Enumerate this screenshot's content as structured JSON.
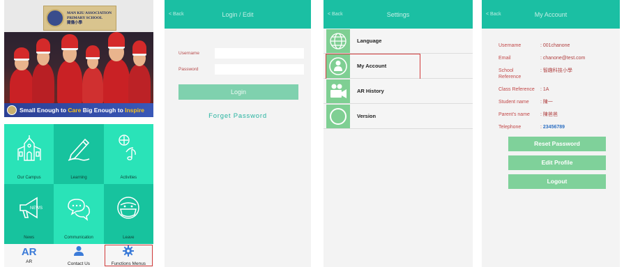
{
  "home": {
    "school_name_line1": "MAN KIU ASSOCIATION",
    "school_name_line2": "PRIMARY SCHOOL",
    "school_name_zh": "閩僑小學",
    "banner_text_a": "Small Enough to ",
    "banner_text_b": "Care",
    "banner_text_c": " Big Enough to ",
    "banner_text_d": "Inspire",
    "tiles": [
      {
        "label": "Our Campus",
        "icon": "school-building-icon"
      },
      {
        "label": "Learning",
        "icon": "pencil-icon"
      },
      {
        "label": "Activities",
        "icon": "music-notes-icon"
      },
      {
        "label": "News",
        "icon": "megaphone-icon"
      },
      {
        "label": "Communication",
        "icon": "chat-bubbles-icon"
      },
      {
        "label": "Leave",
        "icon": "masked-face-icon"
      }
    ],
    "tabs": [
      {
        "label": "AR",
        "glyph": "AR"
      },
      {
        "label": "Contact Us",
        "icon": "contacts-icon"
      },
      {
        "label": "Functions Menus",
        "icon": "gear-icon"
      }
    ]
  },
  "login": {
    "back": "< Back",
    "title": "Login / Edit",
    "username_label": "Username",
    "password_label": "Password",
    "username_value": "",
    "password_value": "",
    "login_button": "Login",
    "forget_link": "Forget Password"
  },
  "settings": {
    "back": "< Back",
    "title": "Settings",
    "items": [
      {
        "label": "Language",
        "icon": "globe-icon"
      },
      {
        "label": "My Account",
        "icon": "account-icon"
      },
      {
        "label": "AR History",
        "icon": "video-camera-icon"
      },
      {
        "label": "Version",
        "icon": "circle-icon"
      }
    ]
  },
  "account": {
    "back": "< Back",
    "title": "My Account",
    "fields": [
      {
        "key": "Username",
        "value": ": 001chanone"
      },
      {
        "key": "Email",
        "value": ": chanone@test.com"
      },
      {
        "key": "School Reference",
        "value": ": 智趣科技小學"
      },
      {
        "key": "Class Reference",
        "value": ": 1A"
      },
      {
        "key": "Student name",
        "value": ": 陳一"
      },
      {
        "key": "Parent's name",
        "value": ": 陳爸爸"
      },
      {
        "key": "Telephone",
        "value": ": ",
        "value2": "23456789"
      }
    ],
    "buttons": [
      "Reset Password",
      "Edit Profile",
      "Logout"
    ]
  },
  "colors": {
    "header": "#1bbfa3",
    "tile_light": "#2ae3b8",
    "tile_dark": "#17c39e",
    "button_green": "#7fd19a",
    "highlight_red": "#d23a3a"
  }
}
